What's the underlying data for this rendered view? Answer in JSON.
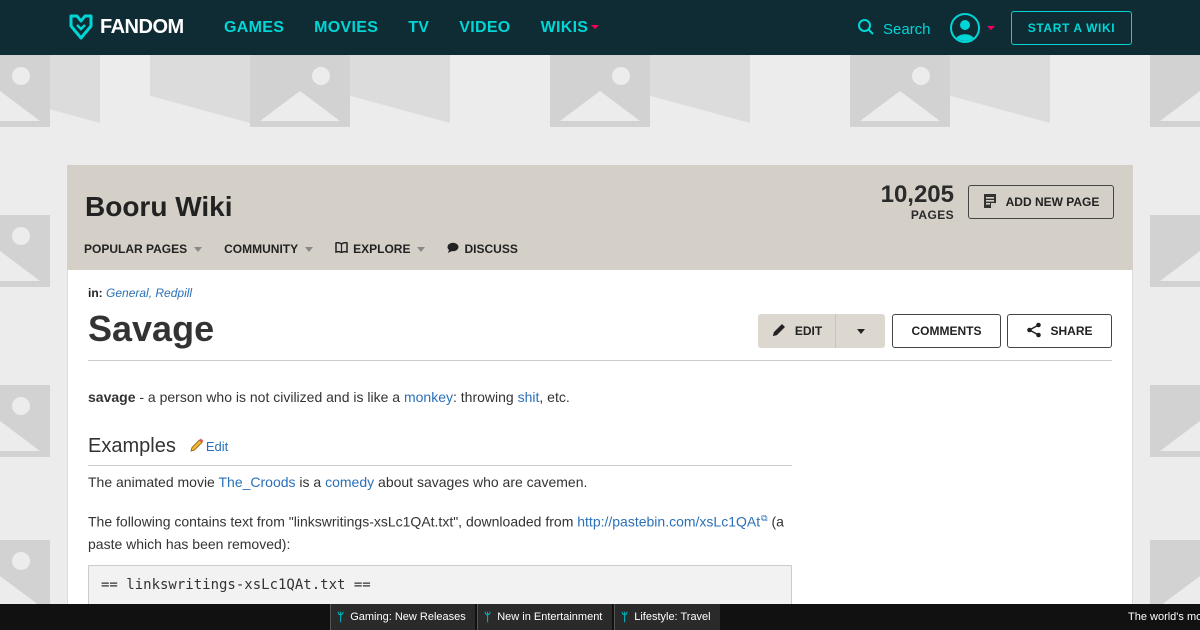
{
  "global_nav": {
    "logo_text": "FANDOM",
    "links": [
      {
        "label": "GAMES",
        "has_caret": false
      },
      {
        "label": "MOVIES",
        "has_caret": false
      },
      {
        "label": "TV",
        "has_caret": false
      },
      {
        "label": "VIDEO",
        "has_caret": false
      },
      {
        "label": "WIKIS",
        "has_caret": true
      }
    ],
    "search_label": "Search",
    "start_wiki_label": "START A WIKI",
    "colors": {
      "bg": "#0f2b34",
      "accent": "#00d6d6",
      "caret": "#fa005a"
    }
  },
  "wiki_header": {
    "title": "Booru Wiki",
    "page_count": "10,205",
    "page_count_label": "PAGES",
    "add_page_label": "ADD NEW PAGE",
    "nav": [
      {
        "label": "POPULAR PAGES",
        "icon": null,
        "has_caret": true
      },
      {
        "label": "COMMUNITY",
        "icon": null,
        "has_caret": true
      },
      {
        "label": "EXPLORE",
        "icon": "book-icon",
        "has_caret": true
      },
      {
        "label": "DISCUSS",
        "icon": "speech-bubble-icon",
        "has_caret": false
      }
    ]
  },
  "page": {
    "categories_label": "in:",
    "categories": [
      "General",
      "Redpill"
    ],
    "title": "Savage",
    "edit_label": "EDIT",
    "comments_label": "COMMENTS",
    "share_label": "SHARE"
  },
  "article": {
    "intro": {
      "term": "savage",
      "text_1": " - a person who is not civilized and is like a ",
      "link_1": "monkey",
      "text_2": ": throwing ",
      "link_2": "shit",
      "text_3": ", etc."
    },
    "section_title": "Examples",
    "section_edit_label": "Edit",
    "para1": {
      "text_1": "The animated movie ",
      "link_1": "The_Croods",
      "text_2": " is a ",
      "link_2": "comedy",
      "text_3": " about savages who are cavemen."
    },
    "para2": {
      "text_1": "The following contains text from \"linkswritings-xsLc1QAt.txt\", downloaded from ",
      "link": "http://pastebin.com/xsLc1QAt",
      "text_2": " (a paste which has been removed):"
    },
    "pre_text": "== linkswritings-xsLc1QAt.txt =="
  },
  "bottom_bar": {
    "tickers": [
      "Gaming: New Releases",
      "New in Entertainment",
      "Lifestyle: Travel"
    ],
    "right_text": "The world's mo"
  }
}
